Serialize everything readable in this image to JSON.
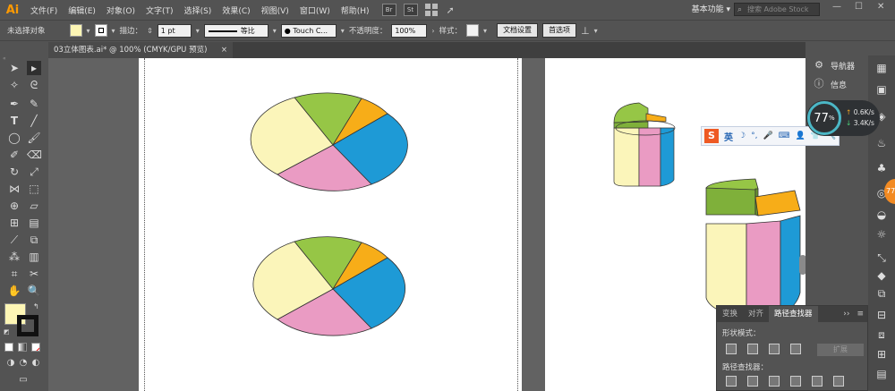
{
  "menubar": {
    "logo": "Ai",
    "items": [
      "文件(F)",
      "编辑(E)",
      "对象(O)",
      "文字(T)",
      "选择(S)",
      "效果(C)",
      "视图(V)",
      "窗口(W)",
      "帮助(H)"
    ],
    "badges": [
      "Br",
      "St"
    ],
    "workspace": "基本功能",
    "search_placeholder": "搜索 Adobe Stock",
    "min": "—",
    "max": "☐",
    "close": "✕"
  },
  "control": {
    "no_selection": "未选择对象",
    "fill_color": "#fdf6b5",
    "stroke_label": "描边：",
    "stroke_value": "1 pt",
    "profile_label": "等比",
    "brush_label": "Touch C...",
    "opacity_label": "不透明度：",
    "opacity_value": "100%",
    "style_label": "样式：",
    "doc_setup": "文档设置",
    "preferences": "首选项"
  },
  "document": {
    "tab_title": "03立体图表.ai* @ 100% (CMYK/GPU 预览)",
    "close": "×"
  },
  "right_panel": {
    "navigator": "导航器",
    "info": "信息"
  },
  "pathfinder": {
    "tabs": [
      "变换",
      "对齐",
      "路径查找器"
    ],
    "shape_modes": "形状模式：",
    "pathfinders": "路径查找器：",
    "expand": "扩展",
    "menu": "≡",
    "collapse": "››"
  },
  "ime": {
    "logo": "S",
    "lang": "英",
    "icons": [
      "☽",
      "°,",
      "🎤",
      "⌨",
      "👤",
      "👕",
      "🔧"
    ]
  },
  "network": {
    "percent": "77",
    "unit": "%",
    "upload": "0.6K/s",
    "download": "3.4K/s"
  },
  "orange_badge": "77",
  "colors": {
    "pie_yellow": "#fbf5ba",
    "pie_green": "#96c646",
    "pie_orange": "#f7ad18",
    "pie_blue": "#1e9ad6",
    "pie_pink": "#ea9bc3",
    "ui_bg": "#535353",
    "accent": "#ff9a00"
  }
}
